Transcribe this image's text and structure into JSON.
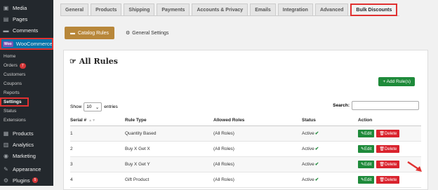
{
  "sidebar": {
    "top_items": [
      {
        "label": "Media",
        "icon": "media-icon"
      },
      {
        "label": "Pages",
        "icon": "pages-icon"
      },
      {
        "label": "Comments",
        "icon": "comments-icon"
      }
    ],
    "woocommerce": {
      "label": "WooCommerce",
      "logo": "Woo"
    },
    "sub_items": [
      {
        "label": "Home"
      },
      {
        "label": "Orders",
        "badge": "7"
      },
      {
        "label": "Customers"
      },
      {
        "label": "Coupons"
      },
      {
        "label": "Reports"
      },
      {
        "label": "Settings"
      },
      {
        "label": "Status"
      },
      {
        "label": "Extensions"
      }
    ],
    "bottom_items": [
      {
        "label": "Products",
        "icon": "products-icon"
      },
      {
        "label": "Analytics",
        "icon": "analytics-icon"
      },
      {
        "label": "Marketing",
        "icon": "marketing-icon"
      },
      {
        "label": "Appearance",
        "icon": "appearance-icon"
      },
      {
        "label": "Plugins",
        "icon": "plugins-icon",
        "badge": "5"
      }
    ]
  },
  "tabs": [
    "General",
    "Products",
    "Shipping",
    "Payments",
    "Accounts & Privacy",
    "Emails",
    "Integration",
    "Advanced",
    "Bulk Discounts"
  ],
  "subnav": {
    "catalog_rules": "Catalog Rules",
    "general_settings": "General Settings"
  },
  "panel": {
    "title": "All Rules",
    "add_button": "+ Add Rule(s)",
    "show_label": "Show",
    "entries_value": "10",
    "entries_label": "entries",
    "search_label": "Search:"
  },
  "table": {
    "headers": [
      "Serial #",
      "Rule Type",
      "Allowed Roles",
      "Status",
      "Action"
    ],
    "rows": [
      {
        "serial": "1",
        "type": "Quantity Based",
        "roles": "(All Roles)",
        "status": "Active"
      },
      {
        "serial": "2",
        "type": "Buy X Get X",
        "roles": "(All Roles)",
        "status": "Active"
      },
      {
        "serial": "3",
        "type": "Buy X Get Y",
        "roles": "(All Roles)",
        "status": "Active"
      },
      {
        "serial": "4",
        "type": "Gift Product",
        "roles": "(All Roles)",
        "status": "Active"
      }
    ],
    "edit_label": "Edit",
    "delete_label": "Delete"
  },
  "colors": {
    "accent": "#b8873a",
    "success": "#1e8a3a",
    "danger": "#d9232d",
    "highlight": "#e03131"
  }
}
